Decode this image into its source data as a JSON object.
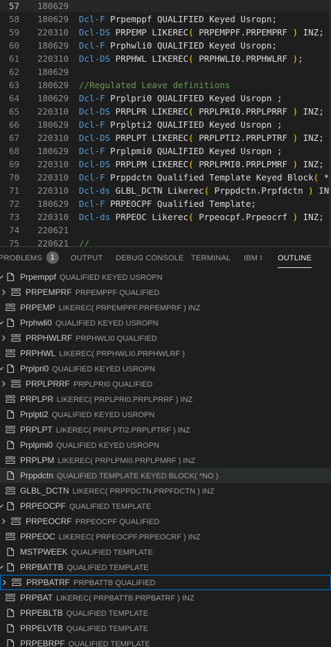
{
  "editor": {
    "lines": [
      {
        "ln": "57",
        "date": "180629",
        "parts": []
      },
      {
        "ln": "58",
        "date": "180629",
        "parts": [
          [
            "kw",
            "Dcl-F"
          ],
          [
            "tx",
            " Prpemppf QUALIFIED Keyed Usropn"
          ],
          [
            "sc",
            ";"
          ]
        ]
      },
      {
        "ln": "59",
        "date": "220310",
        "parts": [
          [
            "kw",
            "Dcl-DS"
          ],
          [
            "tx",
            " PRPEMP LIKEREC"
          ],
          [
            "pn",
            "("
          ],
          [
            "tx",
            " PRPEMPPF.PRPEMPRF "
          ],
          [
            "pn",
            ")"
          ],
          [
            "tx",
            " INZ"
          ],
          [
            "sc",
            ";"
          ]
        ]
      },
      {
        "ln": "60",
        "date": "180629",
        "parts": [
          [
            "kw",
            "Dcl-F"
          ],
          [
            "tx",
            " Prphwli0 QUALIFIED Keyed Usropn"
          ],
          [
            "sc",
            ";"
          ]
        ]
      },
      {
        "ln": "61",
        "date": "220310",
        "parts": [
          [
            "kw",
            "Dcl-DS"
          ],
          [
            "tx",
            " PRPHWL LIKEREC"
          ],
          [
            "pn",
            "("
          ],
          [
            "tx",
            " PRPHWLI0.PRPHWLRF "
          ],
          [
            "pn",
            ")"
          ],
          [
            "sc",
            ";"
          ]
        ]
      },
      {
        "ln": "62",
        "date": "180629",
        "parts": []
      },
      {
        "ln": "63",
        "date": "180629",
        "parts": [
          [
            "cm",
            "//Regulated Leave definitions"
          ]
        ]
      },
      {
        "ln": "64",
        "date": "180629",
        "parts": [
          [
            "kw",
            "Dcl-F"
          ],
          [
            "tx",
            " Prplpri0 QUALIFIED Keyed Usropn "
          ],
          [
            "sc",
            ";"
          ]
        ]
      },
      {
        "ln": "65",
        "date": "220310",
        "parts": [
          [
            "kw",
            "Dcl-DS"
          ],
          [
            "tx",
            " PRPLPR LIKEREC"
          ],
          [
            "pn",
            "("
          ],
          [
            "tx",
            " PRPLPRI0.PRPLPRRF "
          ],
          [
            "pn",
            ")"
          ],
          [
            "tx",
            " INZ"
          ],
          [
            "sc",
            ";"
          ]
        ]
      },
      {
        "ln": "66",
        "date": "180629",
        "parts": [
          [
            "kw",
            "Dcl-F"
          ],
          [
            "tx",
            " Prplpti2 QUALIFIED Keyed Usropn "
          ],
          [
            "sc",
            ";"
          ]
        ]
      },
      {
        "ln": "67",
        "date": "220310",
        "parts": [
          [
            "kw",
            "Dcl-DS"
          ],
          [
            "tx",
            " PRPLPT LIKEREC"
          ],
          [
            "pn",
            "("
          ],
          [
            "tx",
            " PRPLPTI2.PRPLPTRF "
          ],
          [
            "pn",
            ")"
          ],
          [
            "tx",
            " INZ"
          ],
          [
            "sc",
            ";"
          ]
        ]
      },
      {
        "ln": "68",
        "date": "180629",
        "parts": [
          [
            "kw",
            "Dcl-F"
          ],
          [
            "tx",
            " Prplpmi0 QUALIFIED Keyed Usropn "
          ],
          [
            "sc",
            ";"
          ]
        ]
      },
      {
        "ln": "69",
        "date": "220310",
        "parts": [
          [
            "kw",
            "Dcl-DS"
          ],
          [
            "tx",
            " PRPLPM LIKEREC"
          ],
          [
            "pn",
            "("
          ],
          [
            "tx",
            " PRPLPMI0.PRPLPMRF "
          ],
          [
            "pn",
            ")"
          ],
          [
            "tx",
            " INZ"
          ],
          [
            "sc",
            ";"
          ]
        ]
      },
      {
        "ln": "70",
        "date": "220310",
        "parts": [
          [
            "kw",
            "Dcl-F"
          ],
          [
            "tx",
            " Prppdctn Qualified Template Keyed Block"
          ],
          [
            "pn",
            "("
          ],
          [
            "tx",
            " *"
          ]
        ]
      },
      {
        "ln": "71",
        "date": "220310",
        "parts": [
          [
            "kw",
            "Dcl-ds"
          ],
          [
            "tx",
            " GLBL_DCTN Likerec"
          ],
          [
            "pn",
            "("
          ],
          [
            "tx",
            " Prppdctn.Prpfdctn "
          ],
          [
            "pn",
            ")"
          ],
          [
            "tx",
            " IN"
          ]
        ]
      },
      {
        "ln": "72",
        "date": "180629",
        "parts": [
          [
            "kw",
            "Dcl-F"
          ],
          [
            "tx",
            " PRPEOCPF Qualified Template"
          ],
          [
            "sc",
            ";"
          ]
        ]
      },
      {
        "ln": "73",
        "date": "220310",
        "parts": [
          [
            "kw",
            "Dcl-ds"
          ],
          [
            "tx",
            " PRPEOC Likerec"
          ],
          [
            "pn",
            "("
          ],
          [
            "tx",
            " Prpeocpf.Prpeocrf "
          ],
          [
            "pn",
            ")"
          ],
          [
            "tx",
            " INZ"
          ],
          [
            "sc",
            ";"
          ]
        ]
      },
      {
        "ln": "74",
        "date": "220621",
        "parts": []
      },
      {
        "ln": "75",
        "date": "220621",
        "parts": [
          [
            "cm",
            "//"
          ]
        ]
      }
    ]
  },
  "panel": {
    "tabs": [
      {
        "label": "PROBLEMS",
        "badge": "1"
      },
      {
        "label": "OUTPUT"
      },
      {
        "label": "DEBUG CONSOLE"
      },
      {
        "label": "TERMINAL"
      },
      {
        "label": "IBM I"
      },
      {
        "label": "OUTLINE",
        "active": true
      }
    ],
    "outline": [
      {
        "level": 0,
        "chevron": "down",
        "icon": "file-icon",
        "name": "Prpemppf",
        "desc": "QUALIFIED KEYED USROPN"
      },
      {
        "level": 1,
        "chevron": "right",
        "icon": "struct-icon",
        "name": "PRPEMPRF",
        "desc": "PRPEMPPF QUALIFIED"
      },
      {
        "level": 0,
        "chevron": "",
        "icon": "struct-icon",
        "name": "PRPEMP",
        "desc": "LIKEREC( PRPEMPPF.PRPEMPRF ) INZ"
      },
      {
        "level": 0,
        "chevron": "down",
        "icon": "file-icon",
        "name": "Prphwli0",
        "desc": "QUALIFIED KEYED USROPN"
      },
      {
        "level": 1,
        "chevron": "right",
        "icon": "struct-icon",
        "name": "PRPHWLRF",
        "desc": "PRPHWLI0 QUALIFIED"
      },
      {
        "level": 0,
        "chevron": "",
        "icon": "struct-icon",
        "name": "PRPHWL",
        "desc": "LIKEREC( PRPHWLI0.PRPHWLRF )"
      },
      {
        "level": 0,
        "chevron": "down",
        "icon": "file-icon",
        "name": "Prplpri0",
        "desc": "QUALIFIED KEYED USROPN"
      },
      {
        "level": 1,
        "chevron": "right",
        "icon": "struct-icon",
        "name": "PRPLPRRF",
        "desc": "PRPLPRI0 QUALIFIED"
      },
      {
        "level": 0,
        "chevron": "",
        "icon": "struct-icon",
        "name": "PRPLPR",
        "desc": "LIKEREC( PRPLPRI0.PRPLPRRF ) INZ"
      },
      {
        "level": 0,
        "chevron": "",
        "icon": "file-icon",
        "name": "Prplpti2",
        "desc": "QUALIFIED KEYED USROPN"
      },
      {
        "level": 0,
        "chevron": "",
        "icon": "struct-icon",
        "name": "PRPLPT",
        "desc": "LIKEREC( PRPLPTI2.PRPLPTRF ) INZ"
      },
      {
        "level": 0,
        "chevron": "",
        "icon": "file-icon",
        "name": "Prplpmi0",
        "desc": "QUALIFIED KEYED USROPN"
      },
      {
        "level": 0,
        "chevron": "",
        "icon": "struct-icon",
        "name": "PRPLPM",
        "desc": "LIKEREC( PRPLPMI0.PRPLPMRF ) INZ"
      },
      {
        "level": 0,
        "chevron": "",
        "icon": "file-icon",
        "name": "Prppdctn",
        "desc": "QUALIFIED TEMPLATE KEYED BLOCK( *NO )",
        "selected": true
      },
      {
        "level": 0,
        "chevron": "",
        "icon": "struct-icon",
        "name": "GLBL_DCTN",
        "desc": "LIKEREC( PRPPDCTN.PRPFDCTN ) INZ"
      },
      {
        "level": 0,
        "chevron": "down",
        "icon": "file-icon",
        "name": "PRPEOCPF",
        "desc": "QUALIFIED TEMPLATE"
      },
      {
        "level": 1,
        "chevron": "right",
        "icon": "struct-icon",
        "name": "PRPEOCRF",
        "desc": "PRPEOCPF QUALIFIED"
      },
      {
        "level": 0,
        "chevron": "",
        "icon": "struct-icon",
        "name": "PRPEOC",
        "desc": "LIKEREC( PRPEOCPF.PRPEOCRF ) INZ"
      },
      {
        "level": 0,
        "chevron": "",
        "icon": "file-icon",
        "name": "MSTPWEEK",
        "desc": "QUALIFIED TEMPLATE"
      },
      {
        "level": 0,
        "chevron": "down",
        "icon": "file-icon",
        "name": "PRPBATTB",
        "desc": "QUALIFIED TEMPLATE"
      },
      {
        "level": 1,
        "chevron": "right",
        "icon": "struct-icon",
        "name": "PRPBATRF",
        "desc": "PRPBATTB QUALIFIED",
        "focused": true
      },
      {
        "level": 0,
        "chevron": "",
        "icon": "struct-icon",
        "name": "PRPBAT",
        "desc": "LIKEREC( PRPBATTB.PRPBATRF ) INZ"
      },
      {
        "level": 0,
        "chevron": "",
        "icon": "file-icon",
        "name": "PRPEBLTB",
        "desc": "QUALIFIED TEMPLATE"
      },
      {
        "level": 0,
        "chevron": "",
        "icon": "file-icon",
        "name": "PRPELVTB",
        "desc": "QUALIFIED TEMPLATE"
      },
      {
        "level": 0,
        "chevron": "",
        "icon": "file-icon",
        "name": "PRPEBRPF",
        "desc": "QUALIFIED TEMPLATE"
      }
    ]
  }
}
